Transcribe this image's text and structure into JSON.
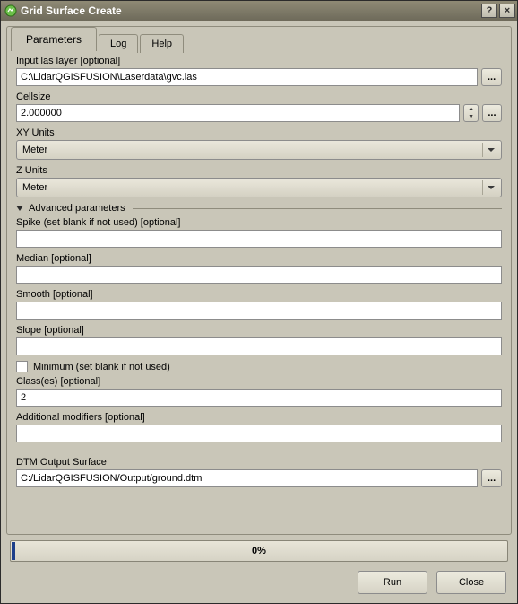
{
  "window": {
    "title": "Grid Surface Create"
  },
  "tabs": {
    "parameters": "Parameters",
    "log": "Log",
    "help": "Help"
  },
  "form": {
    "input_las_label": "Input las layer  [optional]",
    "input_las_value": "C:\\LidarQGISFUSION\\Laserdata\\gvc.las",
    "browse_label": "...",
    "cellsize_label": "Cellsize",
    "cellsize_value": "2.000000",
    "xy_units_label": "XY Units",
    "xy_units_value": "Meter",
    "z_units_label": "Z Units",
    "z_units_value": "Meter",
    "advanced_header": "Advanced parameters",
    "spike_label": "Spike (set blank if not used)  [optional]",
    "spike_value": "",
    "median_label": "Median  [optional]",
    "median_value": "",
    "smooth_label": "Smooth  [optional]",
    "smooth_value": "",
    "slope_label": "Slope  [optional]",
    "slope_value": "",
    "minimum_label": "Minimum (set blank if not used)",
    "minimum_checked": false,
    "classes_label": "Class(es)  [optional]",
    "classes_value": "2",
    "modifiers_label": "Additional modifiers  [optional]",
    "modifiers_value": "",
    "dtm_label": "DTM Output Surface",
    "dtm_value": "C:/LidarQGISFUSION/Output/ground.dtm"
  },
  "progress": {
    "text": "0%",
    "percent": 0
  },
  "buttons": {
    "run": "Run",
    "close": "Close"
  }
}
